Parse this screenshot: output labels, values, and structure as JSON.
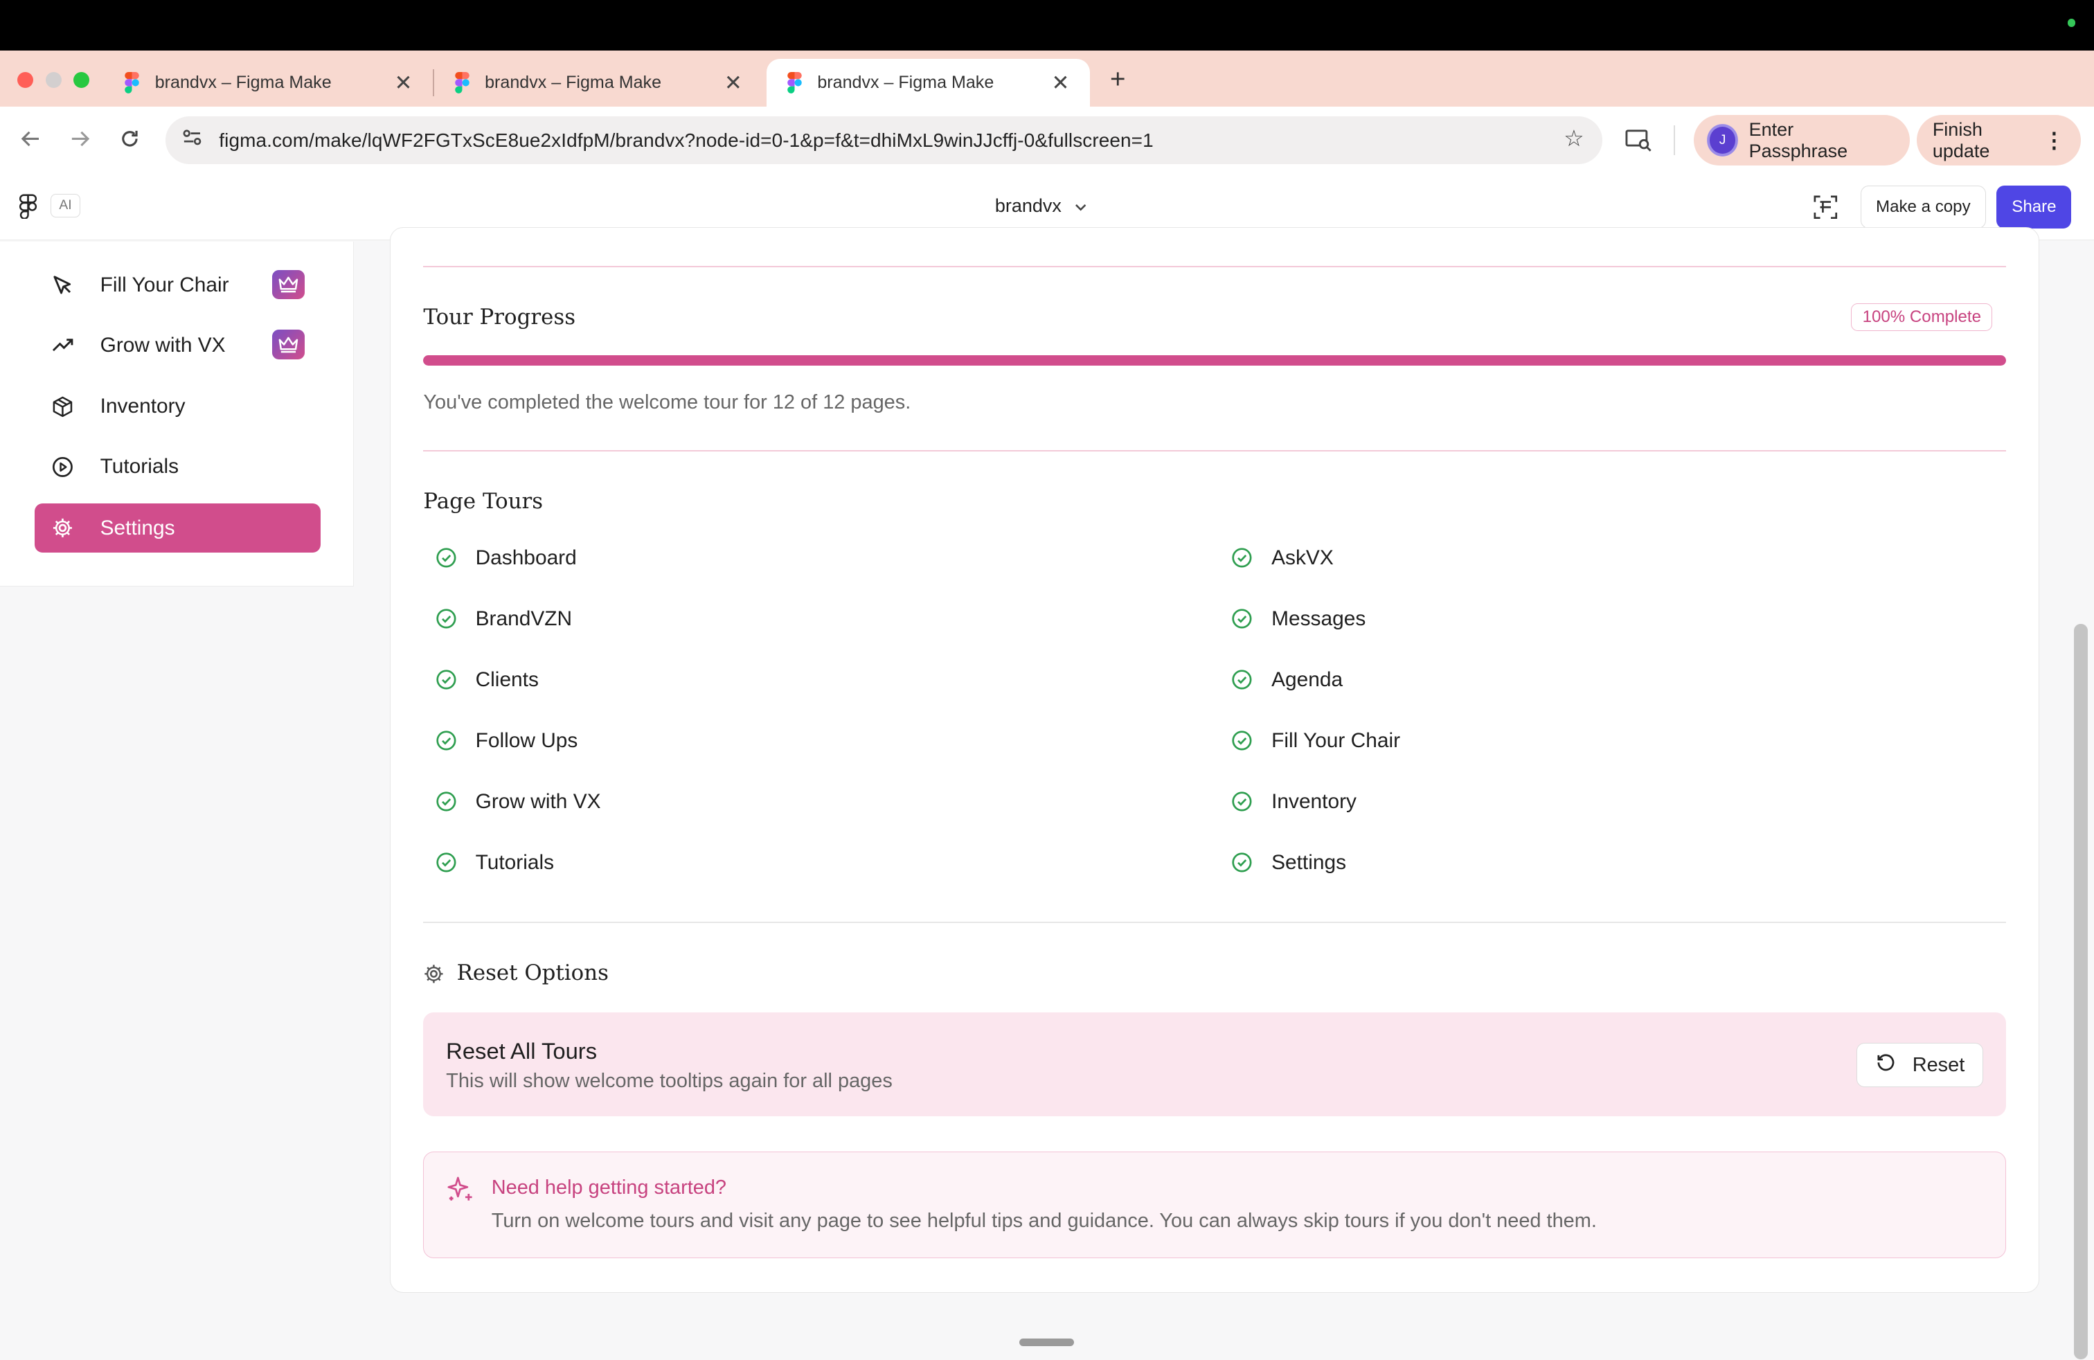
{
  "browser": {
    "tabs": [
      {
        "title": "brandvx – Figma Make"
      },
      {
        "title": "brandvx – Figma Make"
      },
      {
        "title": "brandvx – Figma Make"
      }
    ],
    "url": "figma.com/make/lqWF2FGTxScE8ue2xIdfpM/brandvx?node-id=0-1&p=f&t=dhiMxL9winJJcffj-0&fullscreen=1",
    "profile_label": "Enter Passphrase",
    "profile_initial": "J",
    "update_label": "Finish update"
  },
  "appbar": {
    "ai_label": "AI",
    "project_name": "brandvx",
    "make_copy_label": "Make a copy",
    "share_label": "Share"
  },
  "sidebar": {
    "items": [
      {
        "label": "Fill Your Chair",
        "icon": "cursor-icon",
        "premium": true
      },
      {
        "label": "Grow with VX",
        "icon": "trending-up-icon",
        "premium": true
      },
      {
        "label": "Inventory",
        "icon": "package-icon",
        "premium": false
      },
      {
        "label": "Tutorials",
        "icon": "play-circle-icon",
        "premium": false
      },
      {
        "label": "Settings",
        "icon": "gear-icon",
        "premium": false,
        "active": true
      }
    ]
  },
  "tour_progress": {
    "title": "Tour Progress",
    "badge": "100% Complete",
    "progress_fraction": 1.0,
    "summary": "You've completed the welcome tour for 12 of 12 pages."
  },
  "page_tours": {
    "title": "Page Tours",
    "left": [
      "Dashboard",
      "BrandVZN",
      "Clients",
      "Follow Ups",
      "Grow with VX",
      "Tutorials"
    ],
    "right": [
      "AskVX",
      "Messages",
      "Agenda",
      "Fill Your Chair",
      "Inventory",
      "Settings"
    ]
  },
  "reset_options": {
    "title": "Reset Options",
    "box_title": "Reset All Tours",
    "box_desc": "This will show welcome tooltips again for all pages",
    "button_label": "Reset"
  },
  "help": {
    "title": "Need help getting started?",
    "text": "Turn on welcome tours and visit any page to see helpful tips and guidance. You can always skip tours if you don't need them."
  },
  "colors": {
    "accent": "#d14d8c",
    "share": "#4f46e5",
    "check": "#2e9e4f",
    "tabstrip": "#f8d9d0"
  }
}
